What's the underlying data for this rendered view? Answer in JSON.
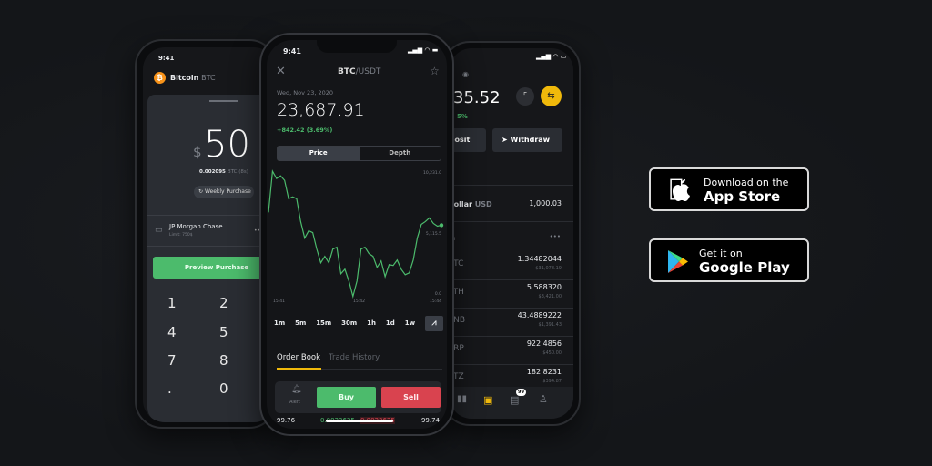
{
  "left_phone": {
    "time": "9:41",
    "coin_name": "Bitcoin",
    "coin_symbol": "BTC",
    "currency_sign": "$",
    "amount": "50",
    "crypto_amount": "0.002095",
    "crypto_unit": "BTC (8s)",
    "recurring_label": "Weekly Purchase",
    "bank_name": "JP Morgan Chase",
    "bank_limit": "Limit: 750$",
    "more": "•••",
    "preview_button": "Preview Purchase",
    "keypad": [
      "1",
      "2",
      "4",
      "5",
      "7",
      "8",
      ".",
      "0"
    ],
    "colors": {
      "accent_green": "#4cbb6c",
      "bitcoin_orange": "#f7931a"
    }
  },
  "middle_phone": {
    "time": "9:41",
    "pair_base": "BTC",
    "pair_quote": "/USDT",
    "date": "Wed, Nov 23, 2020",
    "price": "23,687.91",
    "change": "+842.42 (3.69%)",
    "tabs": [
      "Price",
      "Depth"
    ],
    "active_tab": "Price",
    "y_labels": [
      "10,231.0",
      "5,115.5",
      "0.0"
    ],
    "x_labels": [
      "15:41",
      "15:42",
      "15:44"
    ],
    "chart_values": [
      6891,
      10226,
      9633,
      9855,
      9485,
      8003,
      8151,
      8003,
      6150,
      4817,
      5409,
      5261,
      3927,
      2816,
      3335,
      2816,
      3927,
      4076,
      1927,
      2297,
      1334,
      100,
      1334,
      3927,
      4076,
      3557,
      3335,
      2445,
      2964,
      1704,
      2668,
      2594,
      3038,
      2297,
      1853,
      2001,
      3038,
      4817,
      5928,
      6150,
      6447,
      6002,
      5780,
      5854
    ],
    "intervals": [
      "1m",
      "5m",
      "15m",
      "30m",
      "1h",
      "1d",
      "1w"
    ],
    "book_tabs": [
      "Order Book",
      "Trade History"
    ],
    "alert_label": "Alert",
    "buy_label": "Buy",
    "sell_label": "Sell",
    "order_row": [
      "99.76",
      "0.0023625",
      "0.0023625",
      "99.74"
    ],
    "colors": {
      "buy": "#4cbb6c",
      "sell": "#d9434f",
      "accent": "#f0b90b",
      "line": "#4cbb6c"
    }
  },
  "right_phone": {
    "balance": "35.52",
    "balance_change": "5%",
    "deposit_label": "Deposit",
    "withdraw_label": "Withdraw",
    "fiat_name": "Dollar",
    "fiat_symbol": "USD",
    "fiat_amount": "1,000.03",
    "section_label": "s",
    "more": "•••",
    "assets": [
      {
        "symbol": "BTC",
        "amount": "1.34482044",
        "value": "$31,078.19"
      },
      {
        "symbol": "ETH",
        "amount": "5.588320",
        "value": "$3,421.00"
      },
      {
        "symbol": "BNB",
        "amount": "43.4889222",
        "value": "$1,391.43"
      },
      {
        "symbol": "XRP",
        "amount": "922.4856",
        "value": "$450.00"
      },
      {
        "symbol": "XTZ",
        "amount": "182.8231",
        "value": "$394.87"
      }
    ],
    "notification_badge": "99"
  },
  "store_badges": {
    "app_store": {
      "small": "Download on the",
      "large": "App Store"
    },
    "google_play": {
      "small": "Get it on",
      "large": "Google Play"
    }
  }
}
